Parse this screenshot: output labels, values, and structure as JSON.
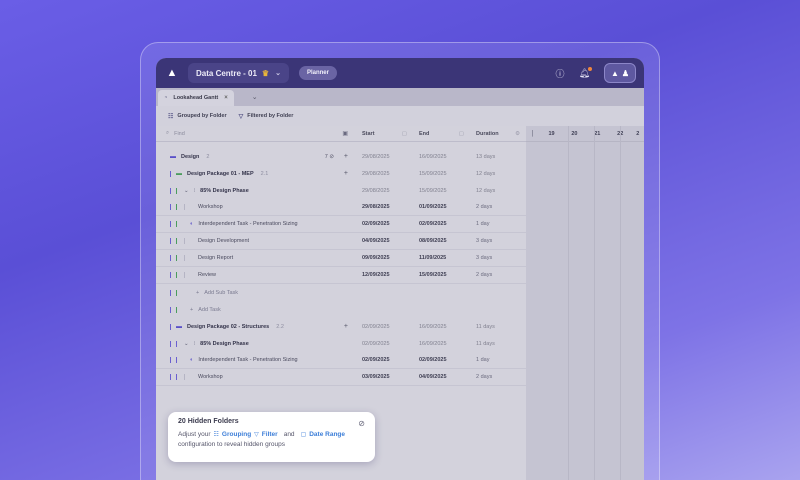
{
  "app": {
    "project_name": "Data Centre - 01",
    "mode_badge": "Planner"
  },
  "tab": {
    "label": "Lookahead Gantt"
  },
  "toolbar": {
    "grouped": "Grouped by Folder",
    "filtered": "Filtered by Folder"
  },
  "grid": {
    "filter_placeholder": "Find",
    "columns": {
      "start": "Start",
      "end": "End",
      "duration": "Duration"
    },
    "rows": [
      {
        "kind": "folder",
        "name": "Design",
        "count": "2",
        "start": "29/08/2025",
        "end": "16/09/2025",
        "dur": "13 days",
        "eyes": "7"
      },
      {
        "kind": "subfolder",
        "name": "Design Package 01 - MEP",
        "count": "2.1",
        "start": "29/08/2025",
        "end": "15/09/2025",
        "dur": "12 days"
      },
      {
        "kind": "phase",
        "name": "85% Design Phase",
        "start": "29/08/2025",
        "end": "15/09/2025",
        "dur": "12 days"
      },
      {
        "kind": "task",
        "name": "Workshop",
        "start": "29/08/2025",
        "end": "01/09/2025",
        "dur": "2 days"
      },
      {
        "kind": "task",
        "name": "Interdependent Task - Penetration Sizing",
        "start": "02/09/2025",
        "end": "02/09/2025",
        "dur": "1 day"
      },
      {
        "kind": "task",
        "name": "Design Development",
        "start": "04/09/2025",
        "end": "08/09/2025",
        "dur": "3 days"
      },
      {
        "kind": "task",
        "name": "Design Report",
        "start": "09/09/2025",
        "end": "11/09/2025",
        "dur": "3 days"
      },
      {
        "kind": "task",
        "name": "Review",
        "start": "12/09/2025",
        "end": "15/09/2025",
        "dur": "2 days"
      },
      {
        "kind": "add",
        "name": "Add Sub Task"
      },
      {
        "kind": "add",
        "name": "Add Task"
      },
      {
        "kind": "subfolder",
        "name": "Design Package 02 - Structures",
        "count": "2.2",
        "start": "02/09/2025",
        "end": "16/09/2025",
        "dur": "11 days"
      },
      {
        "kind": "phase",
        "name": "85% Design Phase",
        "start": "02/09/2025",
        "end": "16/09/2025",
        "dur": "11 days"
      },
      {
        "kind": "task",
        "name": "Interdependent Task - Penetration Sizing",
        "start": "02/09/2025",
        "end": "02/09/2025",
        "dur": "1 day"
      },
      {
        "kind": "task",
        "name": "Workshop",
        "start": "03/09/2025",
        "end": "04/09/2025",
        "dur": "2 days"
      }
    ]
  },
  "gantt": {
    "days": [
      "19",
      "20",
      "21",
      "22",
      "2"
    ]
  },
  "popup": {
    "title": "20 Hidden Folders",
    "prefix": "Adjust your",
    "grouping": "Grouping",
    "filter": "Filter",
    "and": "and",
    "date_range": "Date Range",
    "suffix": "configuration  to reveal hidden groups"
  }
}
